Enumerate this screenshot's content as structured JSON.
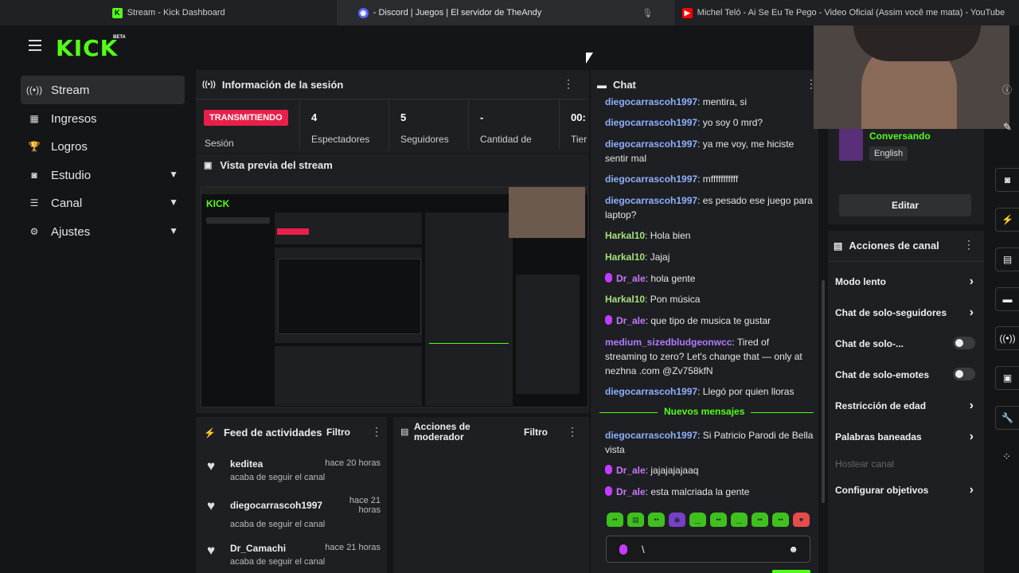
{
  "browser_tabs": [
    {
      "title": "Stream - Kick Dashboard",
      "icon": "kick-favicon",
      "active": false
    },
    {
      "title": "- Discord | Juegos | El servidor de TheAndy",
      "icon": "discord-favicon",
      "active": true
    },
    {
      "title": "Michel Teló - Ai Se Eu Te Pego - Video Oficial (Assim você me mata) - YouTube",
      "icon": "youtube-favicon",
      "active": false
    }
  ],
  "logo": {
    "text": "KICK",
    "badge": "BETA"
  },
  "sidebar": {
    "items": [
      {
        "label": "Stream",
        "icon": "radio-icon",
        "active": true,
        "expandable": false
      },
      {
        "label": "Ingresos",
        "icon": "wallet-icon",
        "active": false,
        "expandable": false
      },
      {
        "label": "Logros",
        "icon": "trophy-icon",
        "active": false,
        "expandable": false
      },
      {
        "label": "Estudio",
        "icon": "camera-icon",
        "active": false,
        "expandable": true
      },
      {
        "label": "Canal",
        "icon": "channel-icon",
        "active": false,
        "expandable": true
      },
      {
        "label": "Ajustes",
        "icon": "gear-icon",
        "active": false,
        "expandable": true
      }
    ]
  },
  "session": {
    "title": "Información de la sesión",
    "status": "TRANSMITIENDO",
    "status_label": "Sesión",
    "stats": [
      {
        "value": "4",
        "label": "Espectadores"
      },
      {
        "value": "5",
        "label": "Seguidores"
      },
      {
        "value": "-",
        "label": "Cantidad de"
      },
      {
        "value": "00:",
        "label": "Tier"
      }
    ]
  },
  "preview": {
    "title": "Vista previa del stream"
  },
  "feed": {
    "title": "Feed de actividades",
    "filter": "Filtro",
    "items": [
      {
        "name": "keditea",
        "time": "hace 20 horas",
        "desc": "acaba de seguir el canal"
      },
      {
        "name": "diegocarrascoh1997",
        "time": "hace 21 horas",
        "desc": "acaba de seguir el canal"
      },
      {
        "name": "Dr_Camachi",
        "time": "hace 21 horas",
        "desc": "acaba de seguir el canal"
      }
    ]
  },
  "moderator": {
    "title": "Acciones de moderador",
    "filter": "Filtro"
  },
  "chat": {
    "title": "Chat",
    "messages": [
      {
        "user": "diegocarrascoh1997",
        "color": "#8db1ff",
        "mic": false,
        "text": ": mentira, si"
      },
      {
        "user": "diegocarrascoh1997",
        "color": "#8db1ff",
        "mic": false,
        "text": ": yo soy 0 mrd?"
      },
      {
        "user": "diegocarrascoh1997",
        "color": "#8db1ff",
        "mic": false,
        "text": ": ya me voy, me hiciste sentir mal"
      },
      {
        "user": "diegocarrascoh1997",
        "color": "#8db1ff",
        "mic": false,
        "text": ": mfffffffffff"
      },
      {
        "user": "diegocarrascoh1997",
        "color": "#8db1ff",
        "mic": false,
        "text": ": es pesado ese juego para laptop?"
      },
      {
        "user": "Harkal10",
        "color": "#a3e27a",
        "mic": false,
        "text": ": Hola bien"
      },
      {
        "user": "Harkal10",
        "color": "#a3e27a",
        "mic": false,
        "text": ": Jajaj"
      },
      {
        "user": "Dr_ale",
        "color": "#c977ff",
        "mic": true,
        "text": ": hola gente"
      },
      {
        "user": "Harkal10",
        "color": "#a3e27a",
        "mic": false,
        "text": ": Pon música"
      },
      {
        "user": "Dr_ale",
        "color": "#c977ff",
        "mic": true,
        "text": ": que tipo de musica te gustar"
      },
      {
        "user": "medium_sizedbludgeonwcc",
        "color": "#b07bff",
        "mic": false,
        "text": ": Tired of streaming to zero? Let's change that — only at nezhna .com @Zv758kfN"
      },
      {
        "user": "diegocarrascoh1997",
        "color": "#8db1ff",
        "mic": false,
        "text": ": Llegó por quien lloras"
      }
    ],
    "new_messages_label": "Nuevos mensajes",
    "new_messages": [
      {
        "user": "diegocarrascoh1997",
        "color": "#8db1ff",
        "mic": false,
        "text": ": Si Patricio Parodi de Bella vista"
      },
      {
        "user": "Dr_ale",
        "color": "#c977ff",
        "mic": true,
        "text": ": jajajajajaaq"
      },
      {
        "user": "Dr_ale",
        "color": "#c977ff",
        "mic": true,
        "text": ": esta malcriada la gente"
      }
    ],
    "input_value": "\\"
  },
  "stream_info": {
    "category": "Conversando",
    "language": "English",
    "edit_label": "Editar"
  },
  "channel_actions": {
    "title": "Acciones de canal",
    "items": [
      {
        "label": "Modo lento",
        "control": "arrow"
      },
      {
        "label": "Chat de solo-seguidores",
        "control": "arrow"
      },
      {
        "label": "Chat de solo-...",
        "control": "toggle"
      },
      {
        "label": "Chat de solo-emotes",
        "control": "toggle"
      },
      {
        "label": "Restricción de edad",
        "control": "arrow"
      },
      {
        "label": "Palabras baneadas",
        "control": "arrow"
      },
      {
        "label": "Hostear canal",
        "control": "disabled"
      },
      {
        "label": "Configurar objetivos",
        "control": "arrow"
      }
    ]
  },
  "colors": {
    "accent": "#53fc18",
    "live": "#e91f4a",
    "panel": "#1e1f22",
    "bg": "#141517"
  }
}
